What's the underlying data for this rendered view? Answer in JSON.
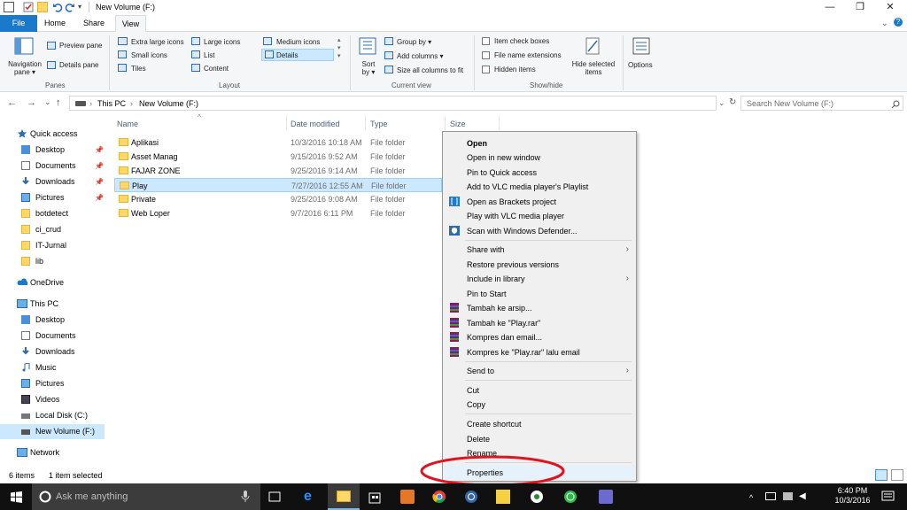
{
  "window": {
    "title": "New Volume (F:)",
    "minimize": "—",
    "maximize": "❐",
    "close": "✕"
  },
  "tabs": {
    "file": "File",
    "home": "Home",
    "share": "Share",
    "view": "View"
  },
  "ribbon": {
    "navigation_pane": "Navigation pane",
    "navigation_pane_l1": "Navigation",
    "navigation_pane_l2": "pane ▾",
    "preview_pane": "Preview pane",
    "details_pane": "Details pane",
    "panes_group": "Panes",
    "extra_large_icons": "Extra large icons",
    "large_icons": "Large icons",
    "medium_icons": "Medium icons",
    "small_icons": "Small icons",
    "list": "List",
    "details": "Details",
    "tiles": "Tiles",
    "content": "Content",
    "layout_group": "Layout",
    "sort_by_l1": "Sort",
    "sort_by_l2": "by ▾",
    "group_by": "Group by ▾",
    "add_columns": "Add columns ▾",
    "size_all_columns": "Size all columns to fit",
    "current_view_group": "Current view",
    "item_check_boxes": "Item check boxes",
    "file_name_extensions": "File name extensions",
    "hidden_items": "Hidden items",
    "hide_selected_l1": "Hide selected",
    "hide_selected_l2": "items",
    "options": "Options",
    "show_hide_group": "Show/hide"
  },
  "address": {
    "back": "←",
    "forward": "→",
    "recent": "⌄",
    "up": "↑",
    "path_this_pc": "This PC",
    "path_sep": "›",
    "path_volume": "New Volume (F:)",
    "dropdown": "⌄",
    "refresh": "↻",
    "search_placeholder": "Search New Volume (F:)"
  },
  "nav": {
    "quick_access": "Quick access",
    "desktop": "Desktop",
    "documents": "Documents",
    "downloads": "Downloads",
    "pictures": "Pictures",
    "botdetect": "botdetect",
    "ci_crud": "ci_crud",
    "it_jurnal": "IT-Jurnal",
    "lib": "lib",
    "onedrive": "OneDrive",
    "this_pc": "This PC",
    "pc_desktop": "Desktop",
    "pc_documents": "Documents",
    "pc_downloads": "Downloads",
    "music": "Music",
    "pc_pictures": "Pictures",
    "videos": "Videos",
    "local_disk": "Local Disk (C:)",
    "new_volume": "New Volume (F:)",
    "network": "Network"
  },
  "columns": {
    "name": "Name",
    "date": "Date modified",
    "type": "Type",
    "size": "Size"
  },
  "files": [
    {
      "name": "Aplikasi",
      "date": "10/3/2016 10:18 AM",
      "type": "File folder"
    },
    {
      "name": "Asset Manag",
      "date": "9/15/2016 9:52 AM",
      "type": "File folder"
    },
    {
      "name": "FAJAR ZONE",
      "date": "9/25/2016 9:14 AM",
      "type": "File folder"
    },
    {
      "name": "Play",
      "date": "7/27/2016 12:55 AM",
      "type": "File folder"
    },
    {
      "name": "Private",
      "date": "9/25/2016 9:08 AM",
      "type": "File folder"
    },
    {
      "name": "Web Loper",
      "date": "9/7/2016 6:11 PM",
      "type": "File folder"
    }
  ],
  "menu": {
    "open": "Open",
    "open_new_window": "Open in new window",
    "pin_quick": "Pin to Quick access",
    "add_vlc": "Add to VLC media player's Playlist",
    "open_brackets": "Open as Brackets project",
    "play_vlc": "Play with VLC media player",
    "scan_defender": "Scan with Windows Defender...",
    "share_with": "Share with",
    "restore_prev": "Restore previous versions",
    "include_library": "Include in library",
    "pin_start": "Pin to Start",
    "tambah_arsip": "Tambah ke arsip...",
    "tambah_play": "Tambah ke \"Play.rar\"",
    "kompres_email": "Kompres dan email...",
    "kompres_play_email": "Kompres ke \"Play.rar\" lalu email",
    "send_to": "Send to",
    "cut": "Cut",
    "copy": "Copy",
    "create_shortcut": "Create shortcut",
    "delete": "Delete",
    "rename": "Rename",
    "properties": "Properties",
    "submenu_arrow": "›"
  },
  "status": {
    "items": "6 items",
    "selected": "1 item selected"
  },
  "taskbar": {
    "search": "Ask me anything",
    "time": "6:40 PM",
    "date": "10/3/2016"
  },
  "colors": {
    "accent": "#1979ca",
    "selection": "#cce8ff",
    "highlight_circle": "#e0141e",
    "taskbar": "#101010"
  }
}
